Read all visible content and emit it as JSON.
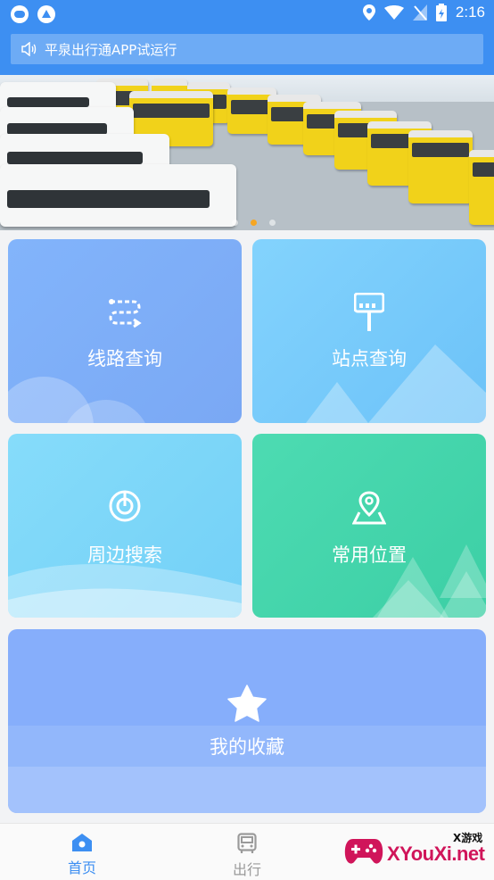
{
  "status_bar": {
    "time": "2:16",
    "left_icons": [
      "notification-icon",
      "app-icon"
    ],
    "right_icons": [
      "location-icon",
      "wifi-icon",
      "no-signal-icon",
      "battery-icon"
    ]
  },
  "notice": {
    "icon": "speaker-icon",
    "text": "平泉出行通APP试运行"
  },
  "banner": {
    "image": "bus-depot-photo",
    "page_count": 3,
    "active_index": 1,
    "indicator_color": "#f6a623"
  },
  "cards": {
    "route_query": {
      "label": "线路查询",
      "icon": "route-icon",
      "color": "#82b4fb"
    },
    "station_query": {
      "label": "站点查询",
      "icon": "bus-stop-icon",
      "color": "#83d3fd"
    },
    "nearby_search": {
      "label": "周边搜索",
      "icon": "radar-icon",
      "color": "#86dcfa"
    },
    "common_places": {
      "label": "常用位置",
      "icon": "location-pin-icon",
      "color": "#4ddbb2"
    },
    "favorites": {
      "label": "我的收藏",
      "icon": "star-icon",
      "color": "#86aefb"
    }
  },
  "tabs": [
    {
      "label": "首页",
      "icon": "home-icon",
      "active": true
    },
    {
      "label": "出行",
      "icon": "bus-icon",
      "active": false
    }
  ],
  "watermark": {
    "small": "X游戏",
    "brand": "XYouXi.net"
  },
  "colors": {
    "primary": "#3d8ff2",
    "tab_inactive": "#9a9a9a"
  }
}
